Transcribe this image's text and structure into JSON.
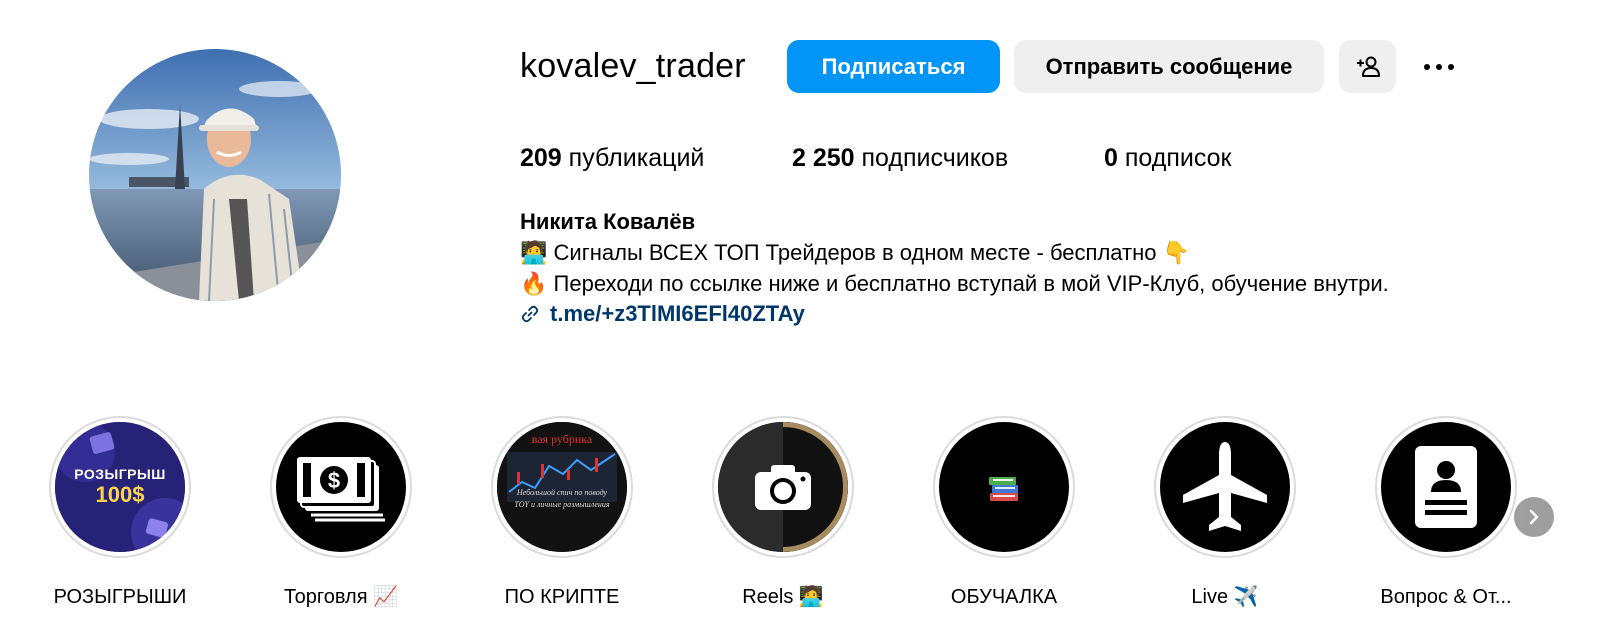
{
  "profile": {
    "username": "kovalev_trader",
    "avatar_icon": "profile-photo"
  },
  "actions": {
    "follow_label": "Подписаться",
    "message_label": "Отправить сообщение",
    "add_user_icon": "add-user-icon",
    "more_icon": "more-horizontal-icon"
  },
  "stats": {
    "posts_count": "209",
    "posts_label": "публикаций",
    "followers_count": "2 250",
    "followers_label": "подписчиков",
    "following_count": "0",
    "following_label": "подписок"
  },
  "bio": {
    "full_name": "Никита Ковалёв",
    "line1_emoji": "🧑‍💻",
    "line1_text": "Сигналы ВСЕХ ТОП Трейдеров в одном месте - бесплатно",
    "line1_emoji_end": "👇",
    "line2_emoji": "🔥",
    "line2_text": "Переходи по ссылке ниже и бесплатно вступай в мой VIP-Клуб, обучение внутри.",
    "link": "t.me/+z3TlMI6EFl40ZTAy"
  },
  "highlights": [
    {
      "label": "РОЗЫГРЫШИ",
      "cover_text_1": "РОЗЫГРЫШ",
      "cover_text_2": "100$"
    },
    {
      "label": "Торговля 📈"
    },
    {
      "label": "ПО КРИПТЕ",
      "cover_text_1": "Небольшой спич по поводу",
      "cover_text_2": "TOY и личные размышления",
      "cover_text_3": "вая рубрика"
    },
    {
      "label": "Reels 🧑‍💻"
    },
    {
      "label": "ОБУЧАЛКА"
    },
    {
      "label": "Live ✈️"
    },
    {
      "label": "Вопрос & От..."
    }
  ],
  "colors": {
    "follow_button": "#0095f6",
    "secondary_button": "#efefef",
    "link": "#00376b"
  }
}
